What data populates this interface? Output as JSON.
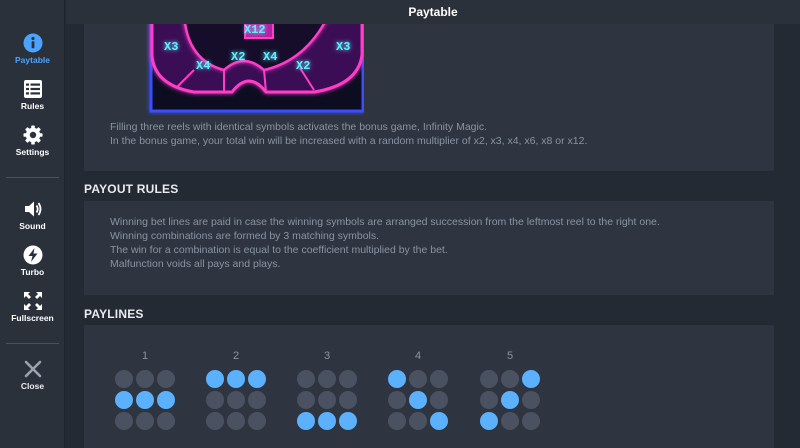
{
  "sidebar": {
    "items": [
      {
        "label": "Paytable",
        "icon": "info-icon",
        "active": true
      },
      {
        "label": "Rules",
        "icon": "list-icon"
      },
      {
        "label": "Settings",
        "icon": "gear-icon"
      },
      {
        "label": "Sound",
        "icon": "speaker-icon"
      },
      {
        "label": "Turbo",
        "icon": "lightning-icon"
      },
      {
        "label": "Fullscreen",
        "icon": "fullscreen-icon"
      },
      {
        "label": "Close",
        "icon": "close-icon"
      }
    ]
  },
  "header": {
    "title": "Paytable"
  },
  "bonus_image": {
    "multipliers": [
      "X12",
      "X3",
      "X2",
      "X4",
      "X4",
      "X2",
      "X3"
    ]
  },
  "bonus": {
    "lines": [
      "Filling three reels with identical symbols activates the bonus game, Infinity Magic.",
      "In the bonus game, your total win will be increased with a random multiplier of x2, x3, x4, x6, x8 or x12."
    ]
  },
  "payout_rules": {
    "title": "PAYOUT RULES",
    "lines": [
      "Winning bet lines are paid in case the winning symbols are arranged succession from the leftmost reel to the right one.",
      "Winning combinations are formed by 3 matching symbols.",
      "The win for a combination is equal to the coefficient multiplied by the bet.",
      "Malfunction voids all pays and plays."
    ]
  },
  "paylines": {
    "title": "PAYLINES",
    "lines": [
      {
        "number": "1",
        "pattern": [
          0,
          0,
          0,
          1,
          1,
          1,
          0,
          0,
          0
        ]
      },
      {
        "number": "2",
        "pattern": [
          1,
          1,
          1,
          0,
          0,
          0,
          0,
          0,
          0
        ]
      },
      {
        "number": "3",
        "pattern": [
          0,
          0,
          0,
          0,
          0,
          0,
          1,
          1,
          1
        ]
      },
      {
        "number": "4",
        "pattern": [
          1,
          0,
          0,
          0,
          1,
          0,
          0,
          0,
          1
        ]
      },
      {
        "number": "5",
        "pattern": [
          0,
          0,
          1,
          0,
          1,
          0,
          1,
          0,
          0
        ]
      }
    ]
  },
  "colors": {
    "accent": "#4aa3ff",
    "dot_on": "#5cb1ff",
    "dot_off": "#4a5261",
    "neon_pink": "#ff3ec8",
    "neon_cyan": "#5ff0ff"
  }
}
